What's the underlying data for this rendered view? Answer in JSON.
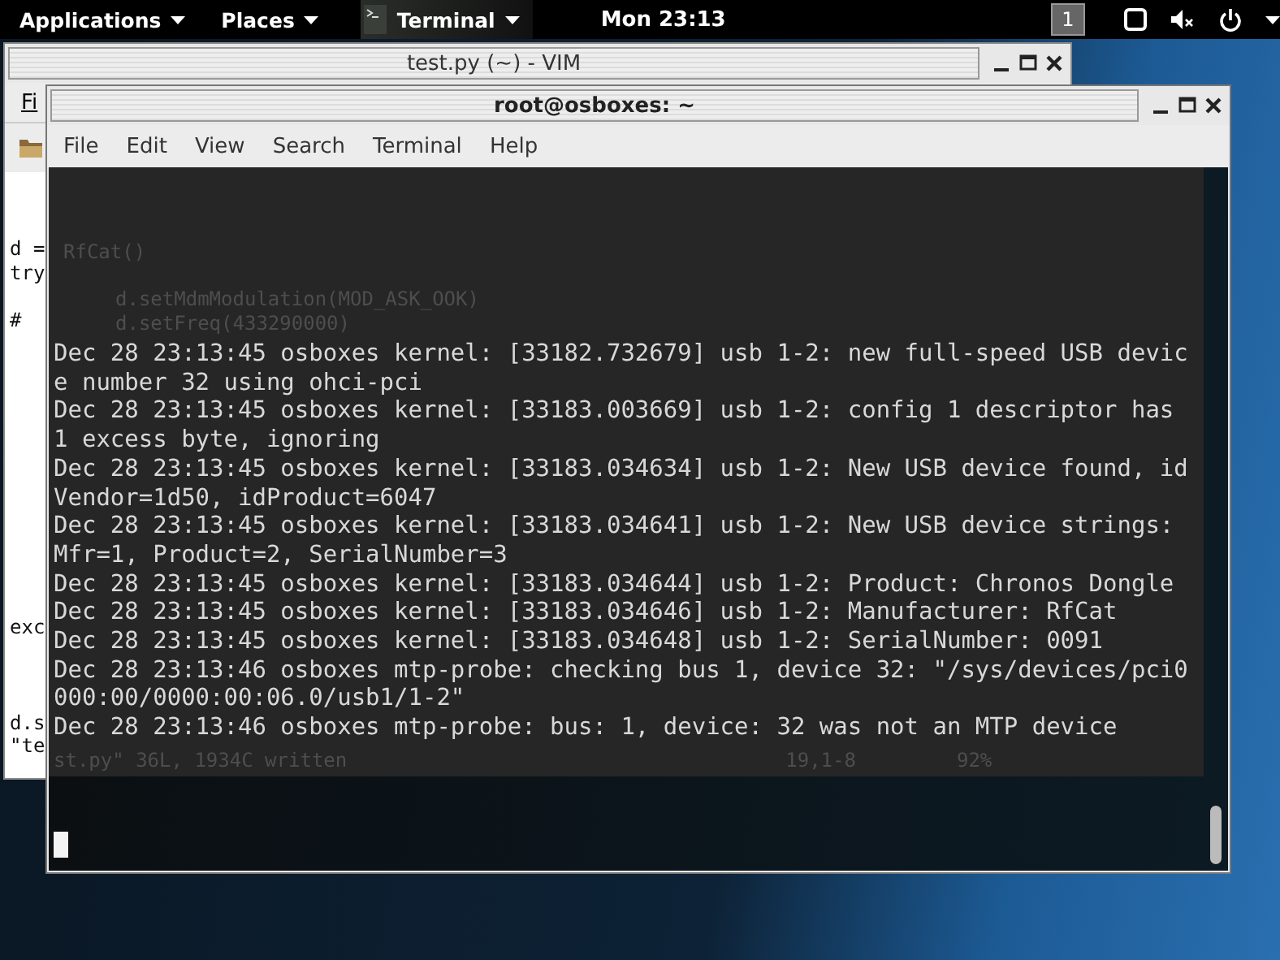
{
  "top_bar": {
    "menus": [
      {
        "label": "Applications",
        "kind": "menu"
      },
      {
        "label": "Places",
        "kind": "menu"
      },
      {
        "label": "Terminal",
        "kind": "app"
      }
    ],
    "clock": "Mon 23:13",
    "workspace": "1"
  },
  "vim_window": {
    "title": "test.py (~) - VIM",
    "menu_fragment": "Fi",
    "code_fragments": [
      "d =",
      "try",
      "#",
      "exc",
      "d.s",
      "\"te"
    ],
    "showing_through": [
      "RfCat()",
      "d.setMdmModulation(MOD_ASK_OOK)",
      "d.setFreq(433290000)"
    ],
    "status_through": {
      "message": "st.py\" 36L, 1934C written",
      "position": "19,1-8",
      "percent": "92%"
    }
  },
  "terminal_window": {
    "title": "root@osboxes: ~",
    "menu": [
      "File",
      "Edit",
      "View",
      "Search",
      "Terminal",
      "Help"
    ],
    "output": [
      "Dec 28 23:13:45 osboxes kernel: [33182.732679] usb 1-2: new full-speed USB devic",
      "e number 32 using ohci-pci",
      "Dec 28 23:13:45 osboxes kernel: [33183.003669] usb 1-2: config 1 descriptor has",
      "1 excess byte, ignoring",
      "Dec 28 23:13:45 osboxes kernel: [33183.034634] usb 1-2: New USB device found, id",
      "Vendor=1d50, idProduct=6047",
      "Dec 28 23:13:45 osboxes kernel: [33183.034641] usb 1-2: New USB device strings:",
      "Mfr=1, Product=2, SerialNumber=3",
      "Dec 28 23:13:45 osboxes kernel: [33183.034644] usb 1-2: Product: Chronos Dongle",
      "Dec 28 23:13:45 osboxes kernel: [33183.034646] usb 1-2: Manufacturer: RfCat",
      "Dec 28 23:13:45 osboxes kernel: [33183.034648] usb 1-2: SerialNumber: 0091",
      "Dec 28 23:13:46 osboxes mtp-probe: checking bus 1, device 32: \"/sys/devices/pci0",
      "000:00/0000:00:06.0/usb1/1-2\"",
      "Dec 28 23:13:46 osboxes mtp-probe: bus: 1, device: 32 was not an MTP device"
    ],
    "cursor": true
  }
}
